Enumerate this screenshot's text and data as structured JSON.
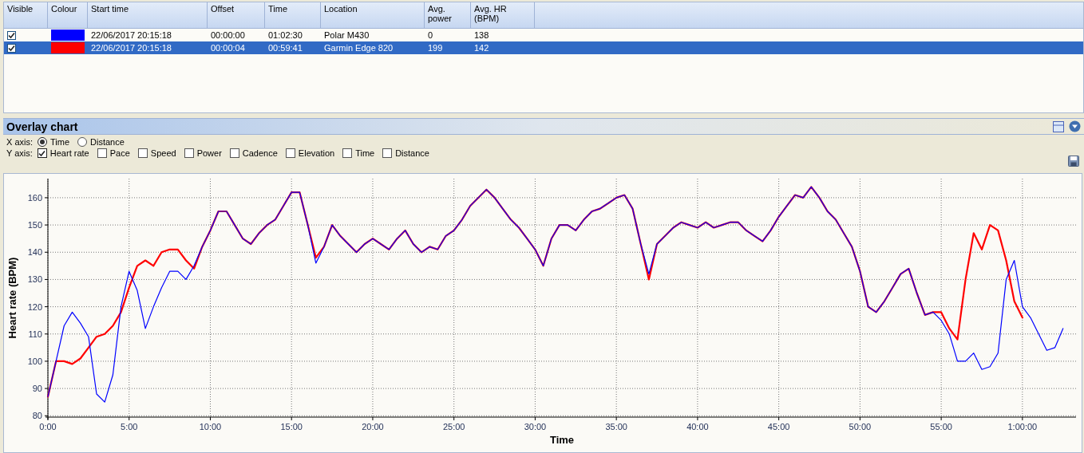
{
  "table": {
    "columns": [
      "Visible",
      "Colour",
      "Start time",
      "Offset",
      "Time",
      "Location",
      "Avg.\npower",
      "Avg. HR\n(BPM)"
    ],
    "rows": [
      {
        "selected": false,
        "cells": [
          {
            "kind": "checkbox",
            "checked": true
          },
          {
            "kind": "swatch",
            "color": "#0000ff"
          },
          "22/06/2017 20:15:18",
          "00:00:00",
          "01:02:30",
          "Polar M430",
          "0",
          "138"
        ]
      },
      {
        "selected": true,
        "cells": [
          {
            "kind": "checkbox",
            "checked": true
          },
          {
            "kind": "swatch",
            "color": "#ff0000"
          },
          "22/06/2017 20:15:18",
          "00:00:04",
          "00:59:41",
          "Garmin Edge 820",
          "199",
          "142"
        ]
      }
    ]
  },
  "overlay": {
    "title": "Overlay chart",
    "x_axis": {
      "label": "X axis:",
      "options": [
        {
          "label": "Time",
          "selected": true
        },
        {
          "label": "Distance",
          "selected": false
        }
      ]
    },
    "y_axis": {
      "label": "Y axis:",
      "options": [
        {
          "label": "Heart rate",
          "checked": true
        },
        {
          "label": "Pace",
          "checked": false
        },
        {
          "label": "Speed",
          "checked": false
        },
        {
          "label": "Power",
          "checked": false
        },
        {
          "label": "Cadence",
          "checked": false
        },
        {
          "label": "Elevation",
          "checked": false
        },
        {
          "label": "Time",
          "checked": false
        },
        {
          "label": "Distance",
          "checked": false
        }
      ]
    },
    "chart_data": {
      "type": "line",
      "grid": true,
      "xlabel": "Time",
      "ylabel": "Heart rate (BPM)",
      "xlim": [
        0,
        63.3
      ],
      "ylim": [
        79.5,
        167
      ],
      "yticks": [
        80,
        90,
        100,
        110,
        120,
        130,
        140,
        150,
        160
      ],
      "xticks": [
        {
          "value": 0,
          "label": "0:00"
        },
        {
          "value": 5,
          "label": "5:00"
        },
        {
          "value": 10,
          "label": "10:00"
        },
        {
          "value": 15,
          "label": "15:00"
        },
        {
          "value": 20,
          "label": "20:00"
        },
        {
          "value": 25,
          "label": "25:00"
        },
        {
          "value": 30,
          "label": "30:00"
        },
        {
          "value": 35,
          "label": "35:00"
        },
        {
          "value": 40,
          "label": "40:00"
        },
        {
          "value": 45,
          "label": "45:00"
        },
        {
          "value": 50,
          "label": "50:00"
        },
        {
          "value": 55,
          "label": "55:00"
        },
        {
          "value": 60,
          "label": "1:00:00"
        }
      ],
      "x": [
        0,
        0.5,
        1,
        1.5,
        2,
        2.5,
        3,
        3.5,
        4,
        4.5,
        5,
        5.5,
        6,
        6.5,
        7,
        7.5,
        8,
        8.5,
        9,
        9.5,
        10,
        10.5,
        11,
        11.5,
        12,
        12.5,
        13,
        13.5,
        14,
        14.5,
        15,
        15.5,
        16,
        16.5,
        17,
        17.5,
        18,
        18.5,
        19,
        19.5,
        20,
        20.5,
        21,
        21.5,
        22,
        22.5,
        23,
        23.5,
        24,
        24.5,
        25,
        25.5,
        26,
        26.5,
        27,
        27.5,
        28,
        28.5,
        29,
        29.5,
        30,
        30.5,
        31,
        31.5,
        32,
        32.5,
        33,
        33.5,
        34,
        34.5,
        35,
        35.5,
        36,
        36.5,
        37,
        37.5,
        38,
        38.5,
        39,
        39.5,
        40,
        40.5,
        41,
        41.5,
        42,
        42.5,
        43,
        43.5,
        44,
        44.5,
        45,
        45.5,
        46,
        46.5,
        47,
        47.5,
        48,
        48.5,
        49,
        49.5,
        50,
        50.5,
        51,
        51.5,
        52,
        52.5,
        53,
        53.5,
        54,
        54.5,
        55,
        55.5,
        56,
        56.5,
        57,
        57.5,
        58,
        58.5,
        59,
        59.5,
        60,
        60.5,
        61,
        61.5,
        62,
        62.5
      ],
      "series": [
        {
          "color": "#0000ff",
          "values": [
            87,
            100,
            113,
            118,
            114,
            109,
            88,
            85,
            95,
            120,
            133,
            126,
            112,
            120,
            127,
            133,
            133,
            130,
            135,
            142,
            148,
            155,
            155,
            150,
            145,
            143,
            147,
            150,
            152,
            157,
            162,
            162,
            150,
            136,
            142,
            150,
            146,
            143,
            140,
            143,
            145,
            143,
            141,
            145,
            148,
            143,
            140,
            142,
            141,
            146,
            148,
            152,
            157,
            160,
            163,
            160,
            156,
            152,
            149,
            145,
            141,
            135,
            145,
            150,
            150,
            148,
            152,
            155,
            156,
            158,
            160,
            161,
            156,
            143,
            132,
            143,
            146,
            149,
            151,
            150,
            149,
            151,
            149,
            150,
            151,
            151,
            148,
            146,
            144,
            148,
            153,
            157,
            161,
            160,
            164,
            160,
            155,
            152,
            147,
            142,
            133,
            120,
            118,
            122,
            127,
            132,
            134,
            125,
            117,
            118,
            115,
            110,
            100,
            100,
            103,
            97,
            98,
            103,
            130,
            137,
            120,
            116,
            110,
            104,
            105,
            112
          ]
        },
        {
          "color": "#ff0000",
          "values": [
            87,
            100,
            100,
            99,
            101,
            105,
            109,
            110,
            113,
            118,
            127,
            135,
            137,
            135,
            140,
            141,
            141,
            137,
            134,
            142,
            148,
            155,
            155,
            150,
            145,
            143,
            147,
            150,
            152,
            157,
            162,
            162,
            150,
            138,
            142,
            150,
            146,
            143,
            140,
            143,
            145,
            143,
            141,
            145,
            148,
            143,
            140,
            142,
            141,
            146,
            148,
            152,
            157,
            160,
            163,
            160,
            156,
            152,
            149,
            145,
            141,
            135,
            145,
            150,
            150,
            148,
            152,
            155,
            156,
            158,
            160,
            161,
            156,
            143,
            130,
            143,
            146,
            149,
            151,
            150,
            149,
            151,
            149,
            150,
            151,
            151,
            148,
            146,
            144,
            148,
            153,
            157,
            161,
            160,
            164,
            160,
            155,
            152,
            147,
            142,
            133,
            120,
            118,
            122,
            127,
            132,
            134,
            125,
            117,
            118,
            118,
            112,
            108,
            130,
            147,
            141,
            150,
            148,
            137,
            122,
            116,
            null,
            null,
            null,
            null,
            null
          ]
        }
      ]
    }
  }
}
